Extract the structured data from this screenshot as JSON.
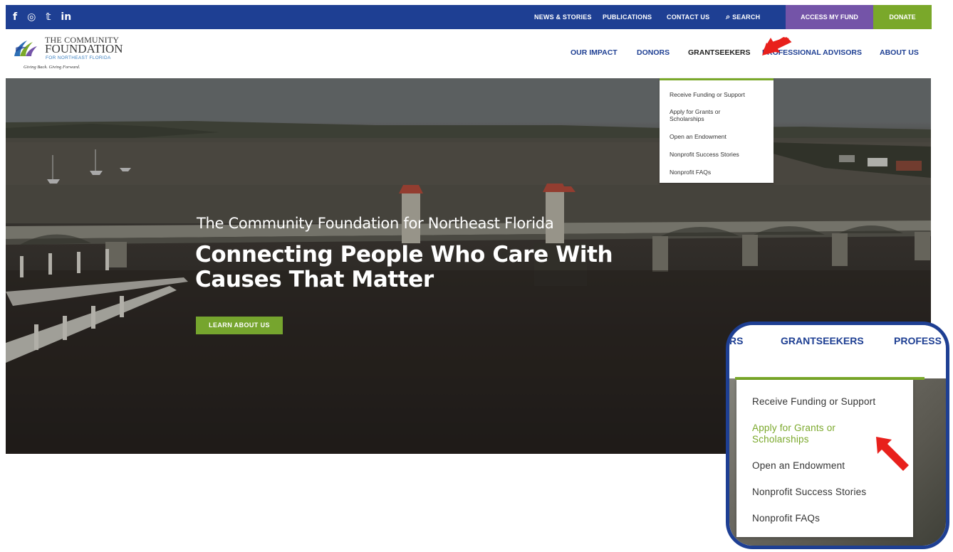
{
  "social": {
    "icons": [
      "facebook-icon",
      "instagram-icon",
      "twitter-icon",
      "linkedin-icon"
    ],
    "glyphs": [
      "f",
      "◎",
      "𝕥",
      "in"
    ]
  },
  "utility": {
    "news": "NEWS & STORIES",
    "publications": "PUBLICATIONS",
    "contact": "CONTACT US",
    "search": "SEARCH",
    "search_icon": "⌕",
    "access": "ACCESS MY FUND",
    "donate": "DONATE"
  },
  "logo": {
    "line1": "THE COMMUNITY",
    "line2": "FOUNDATION",
    "line3": "FOR NORTHEAST FLORIDA",
    "tagline": "Giving Back. Giving Forward."
  },
  "nav": {
    "our_impact": "OUR IMPACT",
    "donors": "DONORS",
    "grantseekers": "GRANTSEEKERS",
    "professional_advisors": "PROFESSIONAL ADVISORS",
    "about_us": "ABOUT US"
  },
  "dropdown": {
    "items": [
      "Receive Funding or Support",
      "Apply for Grants or Scholarships",
      "Open an Endowment",
      "Nonprofit Success Stories",
      "Nonprofit FAQs"
    ]
  },
  "hero": {
    "subtitle": "The Community Foundation for Northeast Florida",
    "title": "Connecting People Who Care With Causes That Matter",
    "button": "LEARN ABOUT US"
  },
  "zoom": {
    "nav_left": "RS",
    "nav_center": "GRANTSEEKERS",
    "nav_right": "PROFESS",
    "items": [
      "Receive Funding or Support",
      "Apply for Grants or Scholarships",
      "Open an Endowment",
      "Nonprofit Success Stories",
      "Nonprofit FAQs"
    ]
  },
  "colors": {
    "brand_blue": "#1e3f93",
    "accent_green": "#7aa82a",
    "access_purple": "#7454a8",
    "arrow_red": "#e8201c"
  }
}
